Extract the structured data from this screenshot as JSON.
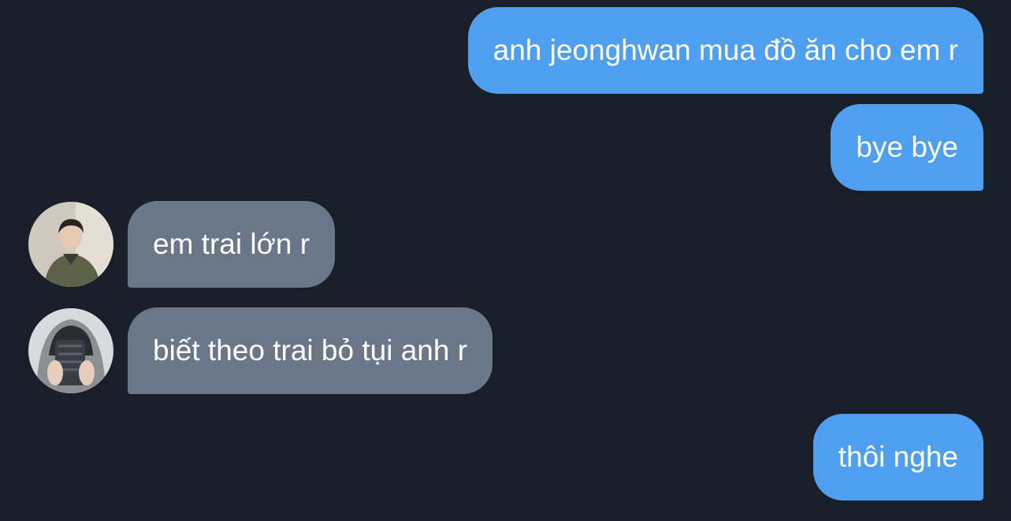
{
  "messages": [
    {
      "direction": "out",
      "text": "anh jeonghwan mua đồ ăn cho em r"
    },
    {
      "direction": "out",
      "text": "bye bye"
    },
    {
      "direction": "in",
      "text": "em trai lớn r",
      "avatar": "avatar-photo-1"
    },
    {
      "direction": "in",
      "text": "biết theo trai bỏ tụi anh r",
      "avatar": "avatar-photo-2"
    },
    {
      "direction": "out",
      "text": "thôi nghe"
    }
  ],
  "colors": {
    "background": "#181f29",
    "outgoing_bubble": "#4f9ff0",
    "incoming_bubble": "#697789",
    "text": "#ffffff"
  }
}
